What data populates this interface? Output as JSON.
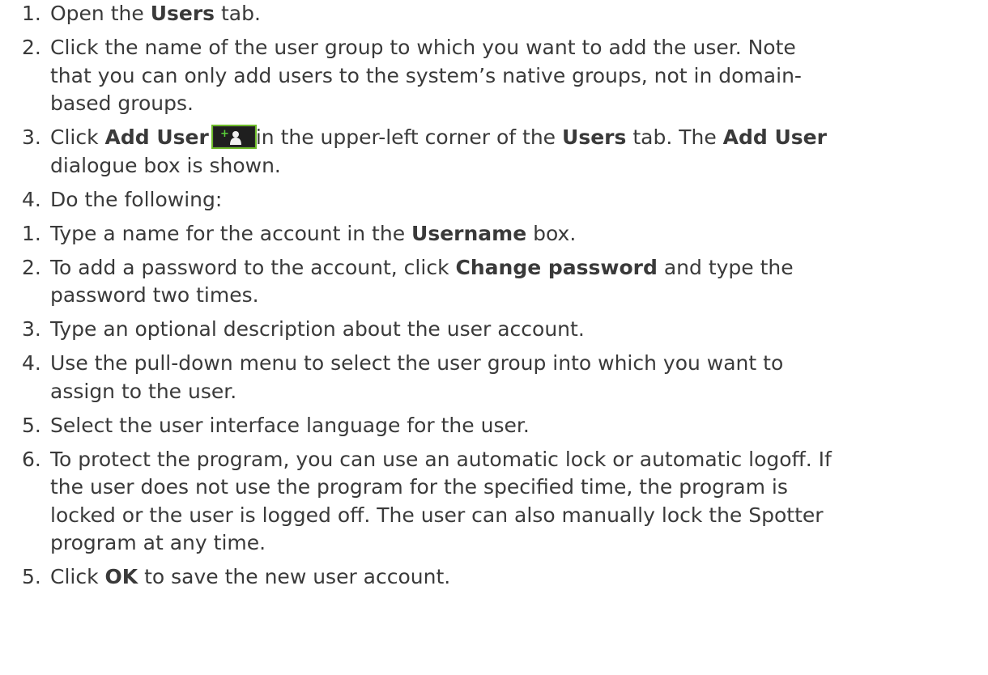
{
  "steps": [
    {
      "num": "1.",
      "t1": "Open the ",
      "b1": "Users",
      "t2": " tab."
    },
    {
      "num": "2.",
      "line1": "Click the name of the user group to which you want to add the user. Note",
      "line2": "that you can only add users to the system’s native groups, not in domain-",
      "line3": "based groups."
    },
    {
      "num": "3.",
      "t1": "Click ",
      "b1": "Add User",
      "t2": "in the upper-left corner of the ",
      "b2": "Users",
      "t3": " tab. The ",
      "b3": "Add User",
      "t4": "dialogue box is shown.",
      "icon": "add-user-icon"
    },
    {
      "num": "4.",
      "text": "Do the following:"
    },
    {
      "num": "1.",
      "t1": "Type a name for the account in the ",
      "b1": "Username",
      "t2": " box."
    },
    {
      "num": "2.",
      "t1": "To add a password to the account, click ",
      "b1": "Change password",
      "t2": " and type the",
      "t3": "password two times."
    },
    {
      "num": "3.",
      "text": "Type an optional description about the user account."
    },
    {
      "num": "4.",
      "line1": "Use the pull-down menu to select the user group into which you want to",
      "line2": "assign to the user."
    },
    {
      "num": "5.",
      "text": "Select the user interface language for the user."
    },
    {
      "num": "6.",
      "line1": "To protect the program, you can use an automatic lock or automatic logoff. If",
      "line2": "the user does not use the program for the specified time, the program is",
      "line3": "locked or the user is logged off. The user can also manually lock the Spotter",
      "line4": "program at any time."
    },
    {
      "num": "5.",
      "t1": "Click ",
      "b1": "OK",
      "t2": " to save the new user account."
    }
  ],
  "colors": {
    "text": "#3a3a3a",
    "icon_bg": "#2b2b2b",
    "icon_border": "#6dbb2a",
    "icon_plus": "#5ad13a"
  }
}
